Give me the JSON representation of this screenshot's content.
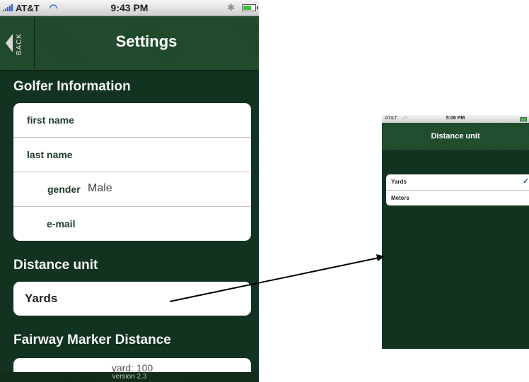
{
  "main_screen": {
    "status_bar": {
      "carrier": "AT&T",
      "time": "9:43 PM"
    },
    "navbar": {
      "back_label": "BACK",
      "title": "Settings"
    },
    "golfer_information": {
      "header": "Golfer Information",
      "rows": [
        {
          "label": "first name",
          "value": ""
        },
        {
          "label": "last name",
          "value": ""
        },
        {
          "label": "gender",
          "value": "Male"
        },
        {
          "label": "e-mail",
          "value": ""
        }
      ]
    },
    "distance_unit": {
      "header": "Distance unit",
      "value": "Yards"
    },
    "fairway_marker": {
      "header": "Fairway Marker Distance",
      "value": "yard: 100"
    },
    "footer": {
      "version": "version 2.3"
    }
  },
  "detail_screen": {
    "status_bar": {
      "carrier": "AT&T",
      "time": "5:06 PM"
    },
    "navbar": {
      "title": "Distance unit"
    },
    "options": [
      {
        "label": "Yards",
        "selected": true
      },
      {
        "label": "Meters",
        "selected": false
      }
    ],
    "check_icon": "checkmark-icon"
  },
  "colors": {
    "background_green": "#12331f",
    "navbar_green": "#1e4a2a",
    "label_green": "#1d3a26",
    "arrow": "#000000"
  }
}
